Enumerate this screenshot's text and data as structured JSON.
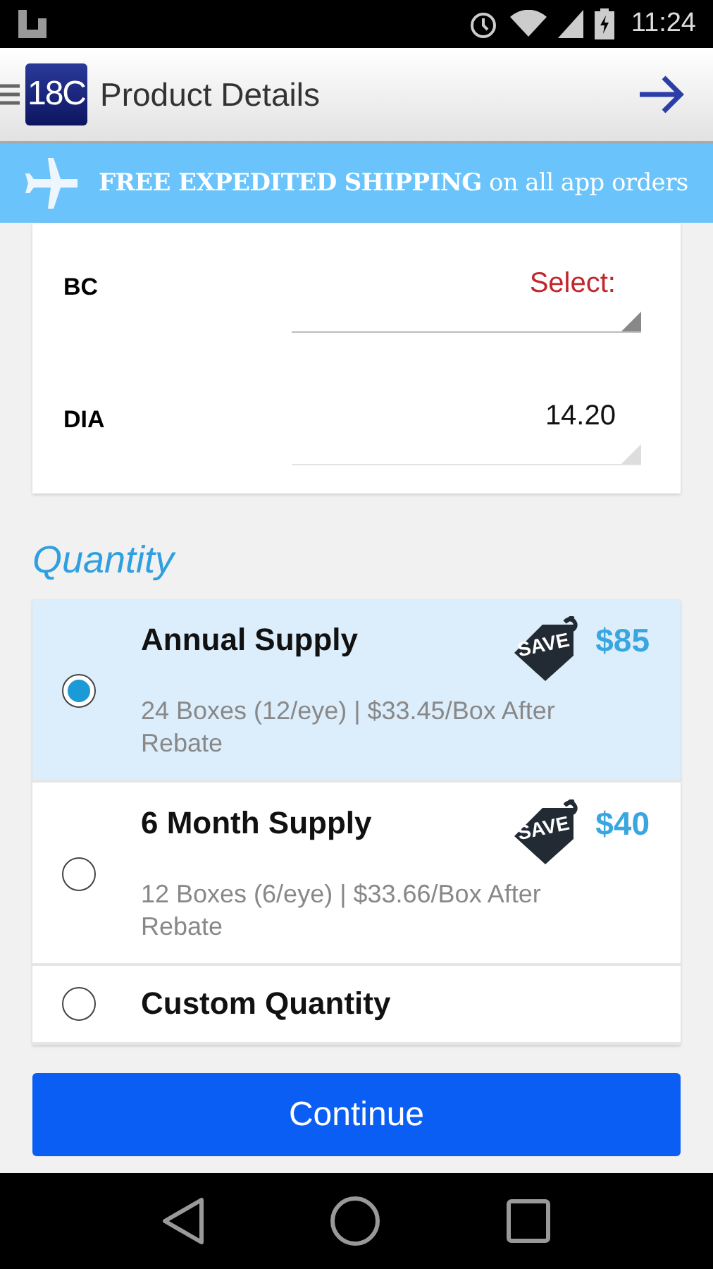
{
  "status_bar": {
    "time": "11:24"
  },
  "app_bar": {
    "logo": "18C",
    "title": "Product Details"
  },
  "banner": {
    "text": "**FREE EXPEDITED SHIPPING** on all app orders"
  },
  "fields": [
    {
      "label": "BC",
      "value": "Select:",
      "kind": "prompt"
    },
    {
      "label": "DIA",
      "value": "14.20",
      "kind": "value"
    }
  ],
  "quantity": {
    "title": "Quantity",
    "options": [
      {
        "name": "Annual Supply",
        "detail": "24 Boxes (12/eye) | $33.45/Box After Rebate",
        "tag": "SAVE",
        "price": "$85",
        "selected": true
      },
      {
        "name": "6 Month Supply",
        "detail": "12 Boxes (6/eye) | $33.66/Box After Rebate",
        "tag": "SAVE",
        "price": "$40",
        "selected": false
      },
      {
        "name": "Custom Quantity",
        "selected": false
      }
    ]
  },
  "continue_button": "Continue"
}
